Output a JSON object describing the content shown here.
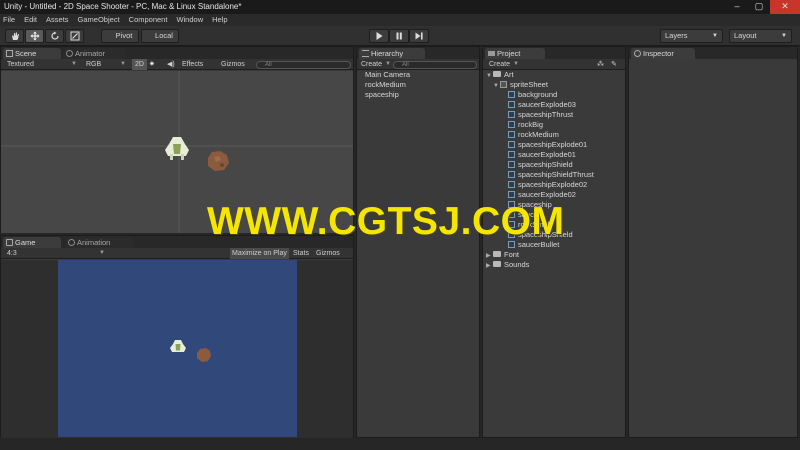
{
  "window": {
    "title": "Unity - Untitled - 2D Space Shooter - PC, Mac & Linux Standalone*",
    "controls": {
      "minimize": "–",
      "maximize": "▢",
      "close": "✕"
    }
  },
  "menu": [
    "File",
    "Edit",
    "Assets",
    "GameObject",
    "Component",
    "Window",
    "Help"
  ],
  "toolbar": {
    "pivot": "Pivot",
    "local": "Local",
    "layers": "Layers",
    "layout": "Layout"
  },
  "scene": {
    "tabs": [
      "Scene",
      "Animator"
    ],
    "shading": "Textured",
    "render_mode": "RGB",
    "mode_2d": "2D",
    "effects": "Effects",
    "gizmos": "Gizmos",
    "search": "All"
  },
  "game": {
    "tabs": [
      "Game",
      "Animation"
    ],
    "aspect": "4:3",
    "maximize": "Maximize on Play",
    "stats": "Stats",
    "gizmos": "Gizmos",
    "background": "#31487a"
  },
  "hierarchy": {
    "tab": "Hierarchy",
    "create": "Create",
    "search": "All",
    "items": [
      "Main Camera",
      "rockMedium",
      "spaceship"
    ]
  },
  "project": {
    "tab": "Project",
    "create": "Create",
    "folders": {
      "art": "Art",
      "sprite_sheet": "spriteSheet",
      "font": "Font",
      "sounds": "Sounds"
    },
    "sprites": [
      "background",
      "saucerExplode03",
      "spaceshipThrust",
      "rockBig",
      "rockMedium",
      "spaceshipExplode01",
      "saucerExplode01",
      "spaceshipShield",
      "spaceshipShieldThrust",
      "spaceshipExplode02",
      "saucerExplode02",
      "spaceship",
      "saucer",
      "rockSmall",
      "spaceshipShield",
      "saucerBullet"
    ]
  },
  "inspector": {
    "tab": "Inspector"
  },
  "watermark": "WWW.CGTSJ.COM"
}
